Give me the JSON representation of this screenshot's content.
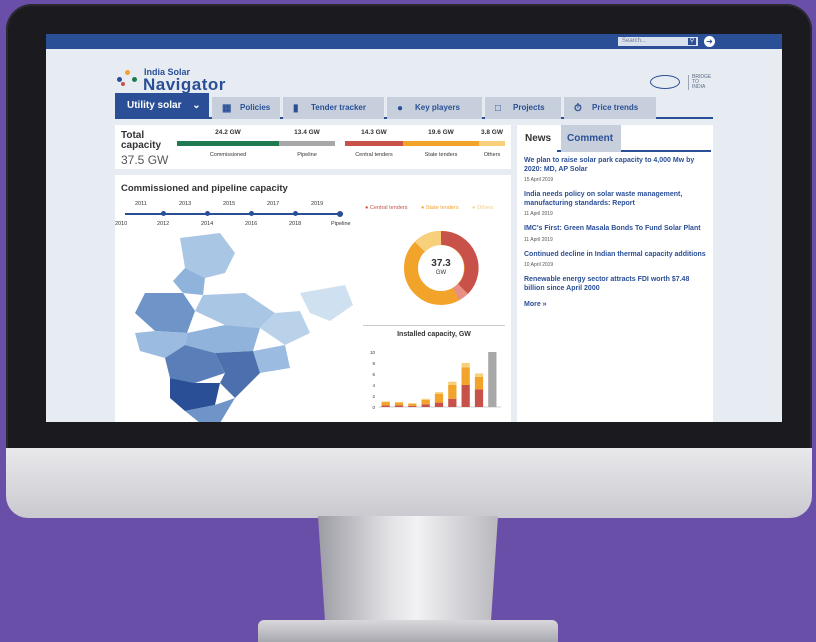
{
  "topbar": {
    "search_placeholder": "Search..."
  },
  "brand": {
    "title_small": "India Solar",
    "title_big": "Navigator",
    "partner_lines": [
      "BRIDGE",
      "TO",
      "INDIA"
    ]
  },
  "nav": {
    "tabs": [
      {
        "label": "Utility solar",
        "icon": "chevron-down-icon",
        "active": true
      },
      {
        "label": "Policies",
        "icon": "policies-icon"
      },
      {
        "label": "Tender tracker",
        "icon": "document-icon"
      },
      {
        "label": "Key players",
        "icon": "people-icon"
      },
      {
        "label": "Projects",
        "icon": "projects-icon"
      },
      {
        "label": "Price trends",
        "icon": "price-icon"
      }
    ]
  },
  "capacity": {
    "title": "Total capacity",
    "total": "37.5 GW",
    "segments": [
      {
        "value": "24.2 GW",
        "label": "Commissioned",
        "color": "#1f7a52"
      },
      {
        "value": "13.4 GW",
        "label": "Pipeline",
        "color": "#a8a8a8"
      },
      {
        "value": "14.3 GW",
        "label": "Central tenders",
        "color": "#c8524a"
      },
      {
        "value": "19.6 GW",
        "label": "State tenders",
        "color": "#f2a32a"
      },
      {
        "value": "3.8 GW",
        "label": "Others",
        "color": "#f8cf7a"
      }
    ]
  },
  "main": {
    "title": "Commissioned and pipeline capacity",
    "timeline_top": [
      "2011",
      "2013",
      "2015",
      "2017",
      "2019"
    ],
    "timeline_bottom": [
      "2010",
      "2012",
      "2014",
      "2016",
      "2018",
      "Pipeline"
    ],
    "legend": [
      {
        "label": "Central tenders",
        "color": "#c8524a"
      },
      {
        "label": "State tenders",
        "color": "#f2a32a"
      },
      {
        "label": "Others",
        "color": "#f8cf7a"
      }
    ],
    "donut_value": "37.3",
    "donut_unit": "GW",
    "bar_title": "Installed capacity, GW"
  },
  "news": {
    "tabs": [
      "News",
      "Comment"
    ],
    "items": [
      {
        "title": "We plan to raise solar park capacity to 4,000 Mw by 2020: MD, AP Solar",
        "date": "15 April 2019"
      },
      {
        "title": "India needs policy on solar waste management, manufacturing standards: Report",
        "date": "11 April 2019"
      },
      {
        "title": "IMC's First: Green Masala Bonds To Fund Solar Plant",
        "date": "11 April 2019"
      },
      {
        "title": "Continued decline in Indian thermal capacity additions",
        "date": "10 April 2019"
      },
      {
        "title": "Renewable energy sector attracts FDI worth $7.48 billion since April 2000",
        "date": ""
      }
    ],
    "more": "More »"
  },
  "chart_data": {
    "type": "bar",
    "title": "Installed capacity, GW",
    "yticks": [
      "10",
      "8",
      "6",
      "4",
      "2",
      "0"
    ],
    "ylim": [
      0,
      10
    ],
    "series": [
      {
        "name": "Central tenders",
        "values": [
          0.3,
          0.3,
          0.2,
          0.5,
          0.8,
          1.5,
          4.0,
          3.2,
          0
        ]
      },
      {
        "name": "State tenders",
        "values": [
          0.6,
          0.5,
          0.4,
          0.8,
          1.6,
          2.5,
          3.2,
          2.3,
          0
        ]
      },
      {
        "name": "Others",
        "values": [
          0.1,
          0.1,
          0.1,
          0.2,
          0.3,
          0.6,
          0.8,
          0.6,
          0
        ]
      },
      {
        "name": "Pipeline",
        "values": [
          0,
          0,
          0,
          0,
          0,
          0,
          0,
          0,
          10.0
        ]
      }
    ],
    "colors": [
      "#c8524a",
      "#f2a32a",
      "#f8cf7a",
      "#a8a8a8"
    ]
  }
}
